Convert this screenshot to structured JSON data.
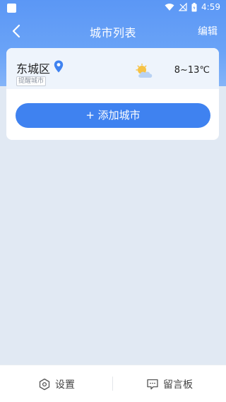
{
  "status_bar": {
    "time": "4:59"
  },
  "app_bar": {
    "title": "城市列表",
    "edit_label": "编辑"
  },
  "city_list": [
    {
      "name": "东城区",
      "tag": "提醒城市",
      "weather_icon": "partly-cloudy-icon",
      "temperature": "8~13℃"
    }
  ],
  "add_city_label": "+ 添加城市",
  "bottom_bar": {
    "settings_label": "设置",
    "message_board_label": "留言板"
  },
  "colors": {
    "header": "#5b97f5",
    "accent": "#3f82f0",
    "page_bg": "#e1e9f3"
  }
}
